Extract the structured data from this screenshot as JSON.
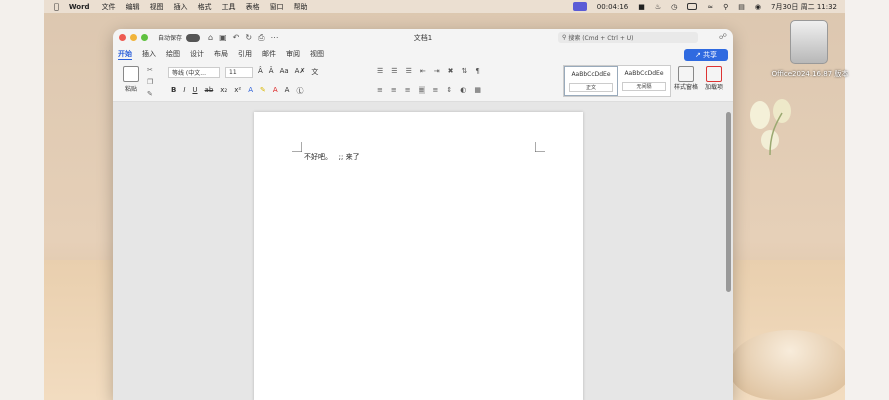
{
  "menubar": {
    "app": "Word",
    "items": [
      "文件",
      "编辑",
      "视图",
      "插入",
      "格式",
      "工具",
      "表格",
      "窗口",
      "帮助"
    ],
    "timer": "00:04:16",
    "datetime": "7月30日 周二 11:32"
  },
  "desktop": {
    "drive_label": "Office2024.16.87 版本"
  },
  "window": {
    "autosave_label": "自动保存",
    "title": "文档1",
    "search_placeholder": "搜索 (Cmd + Ctrl + U)",
    "share_label": "共享"
  },
  "tabs": [
    "开始",
    "插入",
    "绘图",
    "设计",
    "布局",
    "引用",
    "邮件",
    "审阅",
    "视图"
  ],
  "ribbon": {
    "paste_label": "粘贴",
    "font_name": "等线 (中文...",
    "font_size": "11",
    "style_sample_1": "AaBbCcDdEe",
    "style_label_1": "正文",
    "style_sample_2": "AaBbCcDdEe",
    "style_label_2": "无间隔",
    "styles_pane_label": "样式窗格",
    "addins_label": "加载项"
  },
  "document": {
    "text": "不​好吧。   ;; 来了"
  }
}
